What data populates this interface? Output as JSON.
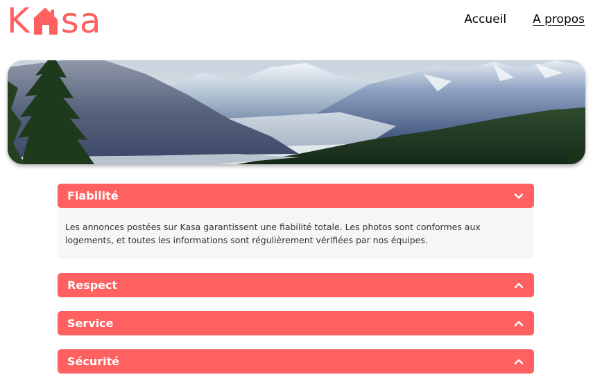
{
  "header": {
    "logo_text_before": "K",
    "logo_text_after": "sa",
    "nav": [
      {
        "label": "Accueil",
        "active": false
      },
      {
        "label": "A propos",
        "active": true
      }
    ]
  },
  "banner": {
    "subject": "mountain-landscape-banner"
  },
  "collapses": [
    {
      "title": "Fiabilité",
      "open": true,
      "content": "Les annonces postées sur Kasa garantissent une fiabilité totale. Les photos sont conformes aux logements, et toutes les informations sont régulièrement vérifiées par nos équipes."
    },
    {
      "title": "Respect",
      "open": false
    },
    {
      "title": "Service",
      "open": false
    },
    {
      "title": "Sécurité",
      "open": false
    }
  ],
  "colors": {
    "brand": "#ff6060",
    "panel": "#f6f6f6"
  },
  "icons": {
    "open": "chevron-down-icon",
    "closed": "chevron-up-icon"
  }
}
